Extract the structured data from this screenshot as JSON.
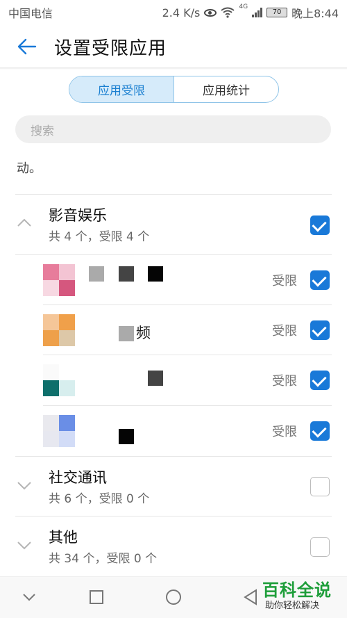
{
  "status": {
    "carrier": "中国电信",
    "speed": "2.4 K/s",
    "network": "4G",
    "battery": "70",
    "time": "晚上8:44"
  },
  "header": {
    "title": "设置受限应用"
  },
  "tabs": [
    {
      "label": "应用受限",
      "active": true
    },
    {
      "label": "应用统计",
      "active": false
    }
  ],
  "search": {
    "placeholder": "搜索"
  },
  "description": {
    "tail": "动。"
  },
  "groups": [
    {
      "title": "影音娱乐",
      "summary": "共 4 个，受限 4 个",
      "expanded": true,
      "checked": true
    },
    {
      "title": "社交通讯",
      "summary": "共 6 个，受限 0 个",
      "expanded": false,
      "checked": false
    },
    {
      "title": "其他",
      "summary": "共 34 个，受限 0 个",
      "expanded": false,
      "checked": false
    }
  ],
  "apps": [
    {
      "name_partial": "",
      "status": "受限",
      "checked": true
    },
    {
      "name_partial": "频",
      "status": "受限",
      "checked": true
    },
    {
      "name_partial": "",
      "status": "受限",
      "checked": true
    },
    {
      "name_partial": "",
      "status": "受限",
      "checked": true
    }
  ],
  "watermark": {
    "brand": "百科全说",
    "slogan": "助你轻松解决"
  },
  "colors": {
    "accent": "#1979d8",
    "tab_active_bg": "#d6ebfa",
    "watermark": "#1e9e3a"
  }
}
